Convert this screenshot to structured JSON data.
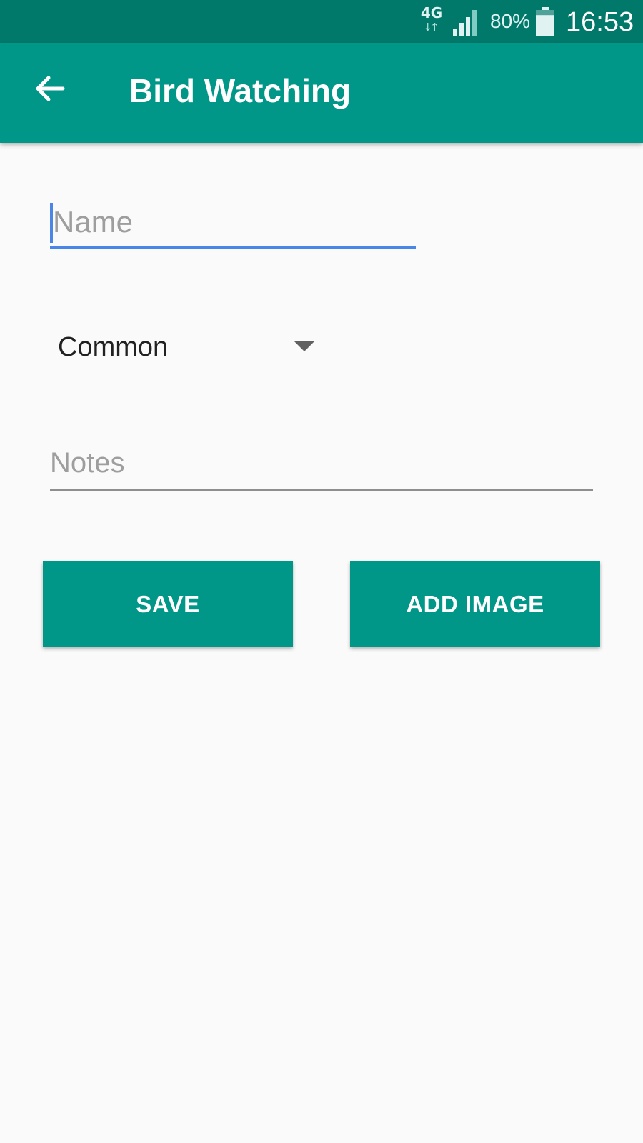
{
  "status_bar": {
    "network": "4G",
    "network_arrows": "↓↑",
    "battery_percent": "80%",
    "battery_level": 0.8,
    "time": "16:53",
    "icons": [
      "signal-icon",
      "battery-icon"
    ]
  },
  "app_bar": {
    "title": "Bird Watching",
    "back_icon": "arrow-left-icon",
    "color": "#009688"
  },
  "form": {
    "name": {
      "placeholder": "Name",
      "value": "",
      "focused": true
    },
    "category": {
      "selected": "Common"
    },
    "notes": {
      "placeholder": "Notes",
      "value": ""
    },
    "buttons": {
      "save": "SAVE",
      "add_image": "ADD IMAGE"
    }
  },
  "colors": {
    "primary": "#009688",
    "primary_dark": "#00796b",
    "accent_focus": "#4a86e8",
    "background": "#fafafa"
  }
}
